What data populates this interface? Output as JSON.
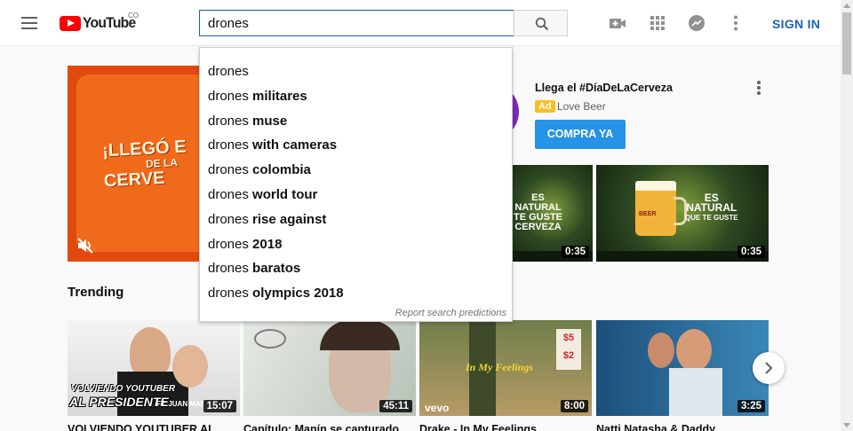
{
  "header": {
    "logo_text": "YouTube",
    "logo_country": "CO",
    "search_value": "drones",
    "signin_label": "SIGN IN"
  },
  "suggestions": {
    "typed": "drones",
    "items": [
      {
        "prefix": "drones",
        "completion": ""
      },
      {
        "prefix": "drones",
        "completion": "militares"
      },
      {
        "prefix": "drones",
        "completion": "muse"
      },
      {
        "prefix": "drones",
        "completion": "with cameras"
      },
      {
        "prefix": "drones",
        "completion": "colombia"
      },
      {
        "prefix": "drones",
        "completion": "world tour"
      },
      {
        "prefix": "drones",
        "completion": "rise against"
      },
      {
        "prefix": "drones",
        "completion": "2018"
      },
      {
        "prefix": "drones",
        "completion": "baratos"
      },
      {
        "prefix": "drones",
        "completion": "olympics 2018"
      }
    ],
    "report_label": "Report search predictions"
  },
  "ad": {
    "banner_line1": "¡LLEGÓ E",
    "banner_line2": "DE LA",
    "banner_line3": "CERVE",
    "title": "Llega el #DíaDeLaCerveza",
    "badge": "Ad",
    "advertiser": "Love Beer",
    "cta": "COMPRA YA",
    "thumbs": [
      {
        "text1": "ES",
        "text2": "NATURAL",
        "text3": "TE GUSTE",
        "text4": "CERVEZA",
        "duration": "0:35"
      },
      {
        "text1": "ES",
        "text2": "NATURAL",
        "text3": "QUE TE GUSTE",
        "text4": "",
        "duration": "0:35"
      }
    ],
    "beer_label": "BEER"
  },
  "trending": {
    "title": "Trending",
    "videos": [
      {
        "title": "VOLVIENDO YOUTUBER AL",
        "duration": "15:07",
        "overlay1": "VOLVIENDO YOUTUBER",
        "overlay2": "AL PRESIDENTE",
        "overlay3": "FT. JUAN MANU"
      },
      {
        "title": "Capítulo: Manín se capturado",
        "duration": "45:11"
      },
      {
        "title": "Drake - In My Feelings",
        "duration": "8:00",
        "overlay1": "In My Feelings",
        "brand": "vevo",
        "price1": "$5",
        "price2": "$2"
      },
      {
        "title": "Natti Natasha & Daddy",
        "duration": "3:25"
      }
    ]
  },
  "colors": {
    "accent": "#1c62b9",
    "brand_red": "#ff0000",
    "cta_blue": "#2793e6",
    "ad_badge": "#fbbf24"
  },
  "icons": [
    "menu-icon",
    "search-icon",
    "video-camera-icon",
    "apps-grid-icon",
    "share-icon",
    "more-vert-icon",
    "mute-icon",
    "chevron-right-icon"
  ]
}
